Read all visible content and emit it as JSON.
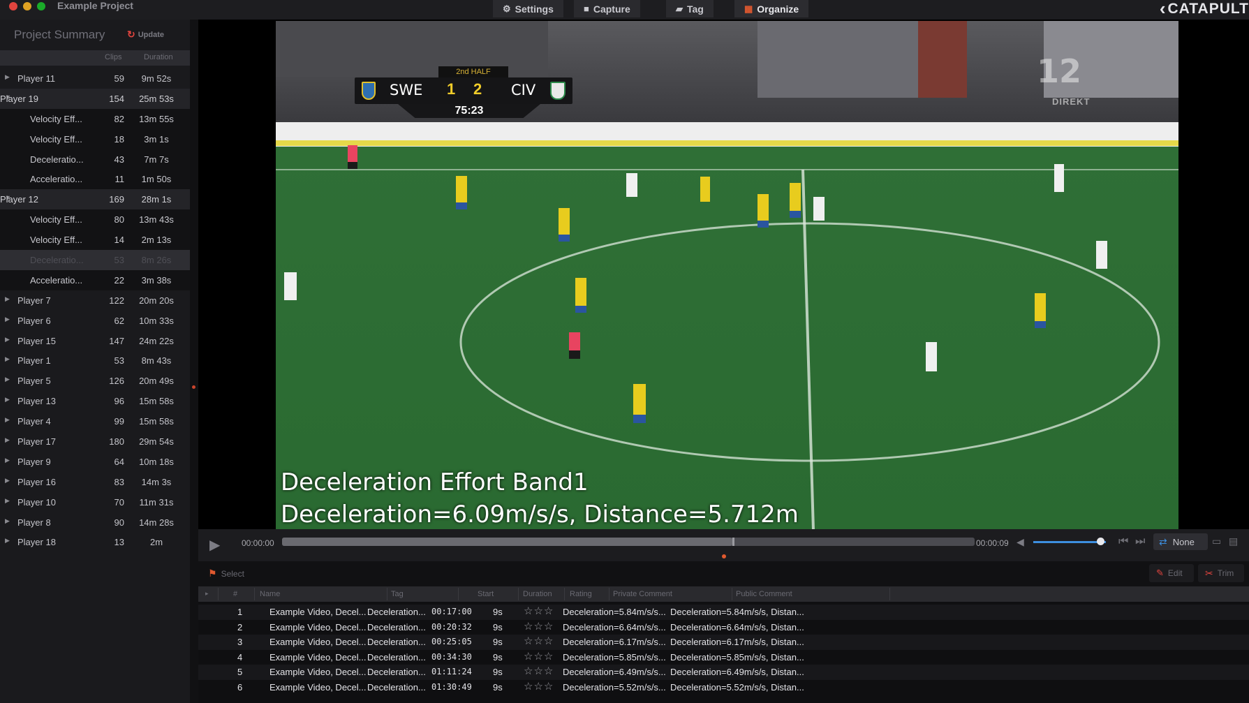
{
  "window": {
    "title": "Example Project"
  },
  "tabs": [
    {
      "label": "Settings",
      "icon": "gear-icon"
    },
    {
      "label": "Capture",
      "icon": "camera-icon"
    },
    {
      "label": "Tag",
      "icon": "tag-icon"
    },
    {
      "label": "Organize",
      "icon": "grid-icon",
      "active": true
    }
  ],
  "brand": {
    "logo_text": "CATAPULT"
  },
  "summary": {
    "title": "Project Summary",
    "update_label": "Update",
    "col_clips": "Clips",
    "col_duration": "Duration",
    "rows": [
      {
        "type": "player",
        "name": "Player 11",
        "clips": "59",
        "duration": "9m 52s"
      },
      {
        "type": "expanded",
        "name": "Player 19",
        "clips": "154",
        "duration": "25m 53s"
      },
      {
        "type": "child",
        "name": "Velocity Eff...",
        "clips": "82",
        "duration": "13m 55s"
      },
      {
        "type": "child",
        "name": "Velocity Eff...",
        "clips": "18",
        "duration": "3m 1s"
      },
      {
        "type": "child",
        "name": "Deceleratio...",
        "clips": "43",
        "duration": "7m 7s"
      },
      {
        "type": "child",
        "name": "Acceleratio...",
        "clips": "11",
        "duration": "1m 50s"
      },
      {
        "type": "expanded",
        "name": "Player 12",
        "clips": "169",
        "duration": "28m 1s"
      },
      {
        "type": "child",
        "name": "Velocity Eff...",
        "clips": "80",
        "duration": "13m 43s"
      },
      {
        "type": "child",
        "name": "Velocity Eff...",
        "clips": "14",
        "duration": "2m 13s"
      },
      {
        "type": "selected",
        "name": "Deceleratio...",
        "clips": "53",
        "duration": "8m 26s"
      },
      {
        "type": "child",
        "name": "Acceleratio...",
        "clips": "22",
        "duration": "3m 38s"
      },
      {
        "type": "player",
        "name": "Player 7",
        "clips": "122",
        "duration": "20m 20s"
      },
      {
        "type": "player",
        "name": "Player 6",
        "clips": "62",
        "duration": "10m 33s"
      },
      {
        "type": "player",
        "name": "Player 15",
        "clips": "147",
        "duration": "24m 22s"
      },
      {
        "type": "player",
        "name": "Player 1",
        "clips": "53",
        "duration": "8m 43s"
      },
      {
        "type": "player",
        "name": "Player 5",
        "clips": "126",
        "duration": "20m 49s"
      },
      {
        "type": "player",
        "name": "Player 13",
        "clips": "96",
        "duration": "15m 58s"
      },
      {
        "type": "player",
        "name": "Player 4",
        "clips": "99",
        "duration": "15m 58s"
      },
      {
        "type": "player",
        "name": "Player 17",
        "clips": "180",
        "duration": "29m 54s"
      },
      {
        "type": "player",
        "name": "Player 9",
        "clips": "64",
        "duration": "10m 18s"
      },
      {
        "type": "player",
        "name": "Player 16",
        "clips": "83",
        "duration": "14m 3s"
      },
      {
        "type": "player",
        "name": "Player 10",
        "clips": "70",
        "duration": "11m 31s"
      },
      {
        "type": "player",
        "name": "Player 8",
        "clips": "90",
        "duration": "14m 28s"
      },
      {
        "type": "player",
        "name": "Player 18",
        "clips": "13",
        "duration": "2m"
      }
    ]
  },
  "video": {
    "caption_line1": "Deceleration Effort Band1",
    "caption_line2": "Deceleration=6.09m/s/s, Distance=5.712m",
    "scoreboard": {
      "period": "2nd HALF",
      "home": "SWE",
      "home_score": "1",
      "away_score": "2",
      "away": "CIV",
      "clock": "75:23"
    },
    "channel_text": "12",
    "channel_sub": "DIREKT"
  },
  "playback": {
    "time_start": "00:00:00",
    "time_end": "00:00:09",
    "loop_label": "None",
    "progress": 0.65,
    "volume": 0.92
  },
  "cliptools": {
    "select_label": "Select",
    "edit_label": "Edit",
    "trim_label": "Trim"
  },
  "clip_table": {
    "headers": [
      "#",
      "Name",
      "Tag",
      "Start",
      "Duration",
      "Rating",
      "Private Comment",
      "Public Comment"
    ],
    "rows": [
      {
        "num": "1",
        "name": "Example Video, Decel...",
        "tag": "Deceleration...",
        "start": "00:17:00",
        "duration": "9s",
        "rating": "☆☆☆",
        "private": "Deceleration=5.84m/s/s...",
        "public": "Deceleration=5.84m/s/s, Distan..."
      },
      {
        "num": "2",
        "name": "Example Video, Decel...",
        "tag": "Deceleration...",
        "start": "00:20:32",
        "duration": "9s",
        "rating": "☆☆☆",
        "private": "Deceleration=6.64m/s/s...",
        "public": "Deceleration=6.64m/s/s, Distan..."
      },
      {
        "num": "3",
        "name": "Example Video, Decel...",
        "tag": "Deceleration...",
        "start": "00:25:05",
        "duration": "9s",
        "rating": "☆☆☆",
        "private": "Deceleration=6.17m/s/s...",
        "public": "Deceleration=6.17m/s/s, Distan..."
      },
      {
        "num": "4",
        "name": "Example Video, Decel...",
        "tag": "Deceleration...",
        "start": "00:34:30",
        "duration": "9s",
        "rating": "☆☆☆",
        "private": "Deceleration=5.85m/s/s...",
        "public": "Deceleration=5.85m/s/s, Distan..."
      },
      {
        "num": "5",
        "name": "Example Video, Decel...",
        "tag": "Deceleration...",
        "start": "01:11:24",
        "duration": "9s",
        "rating": "☆☆☆",
        "private": "Deceleration=6.49m/s/s...",
        "public": "Deceleration=6.49m/s/s, Distan..."
      },
      {
        "num": "6",
        "name": "Example Video, Decel...",
        "tag": "Deceleration...",
        "start": "01:30:49",
        "duration": "9s",
        "rating": "☆☆☆",
        "private": "Deceleration=5.52m/s/s...",
        "public": "Deceleration=5.52m/s/s, Distan..."
      }
    ]
  },
  "colors": {
    "accent_orange": "#e0592f",
    "accent_red": "#e0443e",
    "accent_blue": "#3d8fe0",
    "pitch_green": "#2d6a34"
  }
}
